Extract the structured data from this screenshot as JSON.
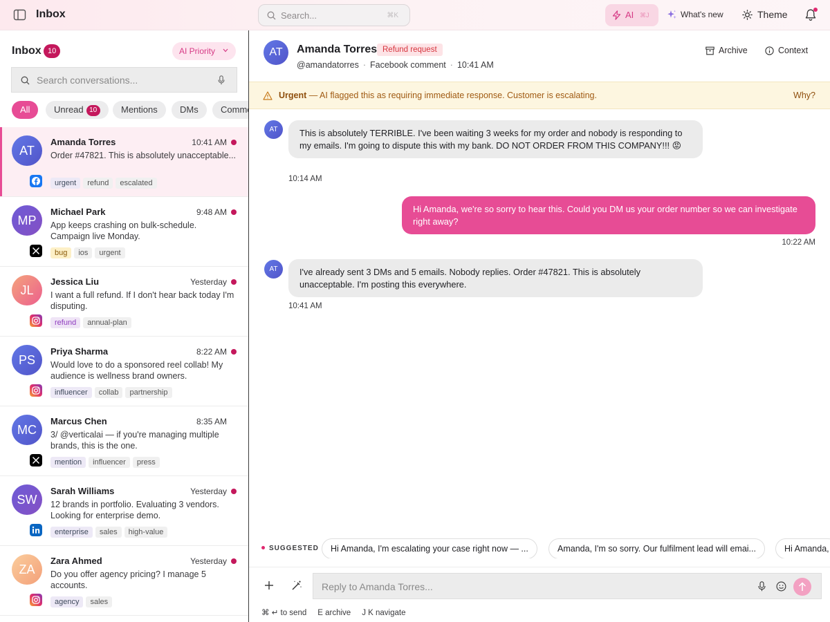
{
  "topbar": {
    "title": "Inbox",
    "search_placeholder": "Search...",
    "search_shortcut": "⌘K",
    "ai_label": "AI",
    "ai_shortcut": "⌘J",
    "whats_new_label": "What's new",
    "theme_label": "Theme"
  },
  "sidebar": {
    "title": "Inbox",
    "count": "10",
    "priority_label": "AI Priority",
    "search_placeholder": "Search conversations...",
    "filters": [
      {
        "label": "All",
        "count": ""
      },
      {
        "label": "Unread",
        "count": "10"
      },
      {
        "label": "Mentions",
        "count": ""
      },
      {
        "label": "DMs",
        "count": ""
      },
      {
        "label": "Comments",
        "count": ""
      }
    ],
    "conversations": [
      {
        "initials": "AT",
        "name": "Amanda Torres",
        "time": "10:41 AM",
        "preview": "Order #47821. This is absolutely unacceptable...",
        "tags": [
          "urgent",
          "refund",
          "escalated"
        ],
        "platform": "facebook"
      },
      {
        "initials": "MP",
        "name": "Michael Park",
        "time": "9:48 AM",
        "preview": "App keeps crashing on bulk-schedule. Campaign live Monday.",
        "tags": [
          "bug",
          "ios",
          "urgent"
        ],
        "platform": "x"
      },
      {
        "initials": "JL",
        "name": "Jessica Liu",
        "time": "Yesterday",
        "preview": "I want a full refund. If I don't hear back today I'm disputing.",
        "tags": [
          "refund",
          "annual-plan"
        ],
        "platform": "instagram"
      },
      {
        "initials": "PS",
        "name": "Priya Sharma",
        "time": "8:22 AM",
        "preview": "Would love to do a sponsored reel collab! My audience is wellness brand owners.",
        "tags": [
          "influencer",
          "collab",
          "partnership"
        ],
        "platform": "instagram"
      },
      {
        "initials": "MC",
        "name": "Marcus Chen",
        "time": "8:35 AM",
        "preview": "3/ @verticalai — if you're managing multiple brands, this is the one.",
        "tags": [
          "mention",
          "influencer",
          "press"
        ],
        "platform": "x"
      },
      {
        "initials": "SW",
        "name": "Sarah Williams",
        "time": "Yesterday",
        "preview": "12 brands in portfolio. Evaluating 3 vendors. Looking for enterprise demo.",
        "tags": [
          "enterprise",
          "sales",
          "high-value"
        ],
        "platform": "linkedin"
      },
      {
        "initials": "ZA",
        "name": "Zara Ahmed",
        "time": "Yesterday",
        "preview": "Do you offer agency pricing? I manage 5 accounts.",
        "tags": [
          "agency",
          "sales"
        ],
        "platform": "instagram"
      }
    ]
  },
  "main": {
    "contact": {
      "initials": "AT",
      "name": "Amanda Torres",
      "badge": "Refund request",
      "handle": "@amandatorres",
      "channel": "Facebook comment",
      "time": "10:41 AM"
    },
    "archive_label": "Archive",
    "context_label": "Context",
    "alert": {
      "title": "Urgent",
      "text": "— AI flagged this as requiring immediate response. Customer is escalating.",
      "why_label": "Why?"
    },
    "messages": [
      {
        "direction": "in",
        "initials": "AT",
        "text": "This is absolutely TERRIBLE. I've been waiting 3 weeks for my order and nobody is responding to my emails. I'm going to dispute this with my bank. DO NOT ORDER FROM THIS COMPANY!!! 😡",
        "time": "10:14 AM"
      },
      {
        "direction": "out",
        "initials": "",
        "text": "Hi Amanda, we're so sorry to hear this. Could you DM us your order number so we can investigate right away?",
        "time": "10:22 AM"
      },
      {
        "direction": "in",
        "initials": "AT",
        "text": "I've already sent 3 DMs and 5 emails. Nobody replies. Order #47821. This is absolutely unacceptable. I'm posting this everywhere.",
        "time": "10:41 AM"
      }
    ],
    "suggested": {
      "label": "SUGGESTED",
      "items": [
        "Hi Amanda, I'm escalating your case right now — ...",
        "Amanda, I'm so sorry. Our fulfilment lead will emai...",
        "Hi Amanda,"
      ]
    },
    "composer": {
      "placeholder": "Reply to Amanda Torres...",
      "shortcut_send": "⌘ ↵ to send",
      "shortcut_archive": "E archive",
      "shortcut_navigate": "J K navigate"
    }
  },
  "colors": {
    "accent": "#e74c95",
    "badge": "#c4185c",
    "urgent_bg": "#fdf6e0"
  }
}
